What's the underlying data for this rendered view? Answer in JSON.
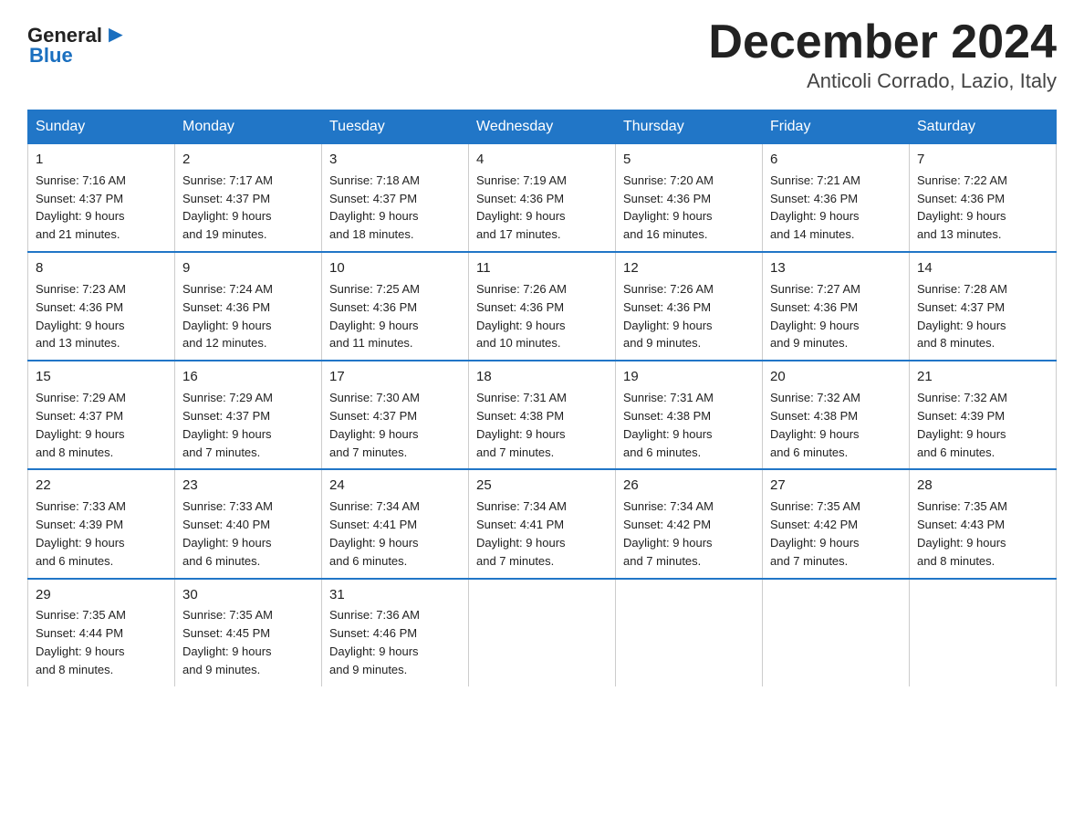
{
  "header": {
    "logo_general": "General",
    "logo_blue": "Blue",
    "month_title": "December 2024",
    "location": "Anticoli Corrado, Lazio, Italy"
  },
  "days_of_week": [
    "Sunday",
    "Monday",
    "Tuesday",
    "Wednesday",
    "Thursday",
    "Friday",
    "Saturday"
  ],
  "weeks": [
    [
      {
        "day": "1",
        "sunrise": "7:16 AM",
        "sunset": "4:37 PM",
        "daylight": "9 hours and 21 minutes."
      },
      {
        "day": "2",
        "sunrise": "7:17 AM",
        "sunset": "4:37 PM",
        "daylight": "9 hours and 19 minutes."
      },
      {
        "day": "3",
        "sunrise": "7:18 AM",
        "sunset": "4:37 PM",
        "daylight": "9 hours and 18 minutes."
      },
      {
        "day": "4",
        "sunrise": "7:19 AM",
        "sunset": "4:36 PM",
        "daylight": "9 hours and 17 minutes."
      },
      {
        "day": "5",
        "sunrise": "7:20 AM",
        "sunset": "4:36 PM",
        "daylight": "9 hours and 16 minutes."
      },
      {
        "day": "6",
        "sunrise": "7:21 AM",
        "sunset": "4:36 PM",
        "daylight": "9 hours and 14 minutes."
      },
      {
        "day": "7",
        "sunrise": "7:22 AM",
        "sunset": "4:36 PM",
        "daylight": "9 hours and 13 minutes."
      }
    ],
    [
      {
        "day": "8",
        "sunrise": "7:23 AM",
        "sunset": "4:36 PM",
        "daylight": "9 hours and 13 minutes."
      },
      {
        "day": "9",
        "sunrise": "7:24 AM",
        "sunset": "4:36 PM",
        "daylight": "9 hours and 12 minutes."
      },
      {
        "day": "10",
        "sunrise": "7:25 AM",
        "sunset": "4:36 PM",
        "daylight": "9 hours and 11 minutes."
      },
      {
        "day": "11",
        "sunrise": "7:26 AM",
        "sunset": "4:36 PM",
        "daylight": "9 hours and 10 minutes."
      },
      {
        "day": "12",
        "sunrise": "7:26 AM",
        "sunset": "4:36 PM",
        "daylight": "9 hours and 9 minutes."
      },
      {
        "day": "13",
        "sunrise": "7:27 AM",
        "sunset": "4:36 PM",
        "daylight": "9 hours and 9 minutes."
      },
      {
        "day": "14",
        "sunrise": "7:28 AM",
        "sunset": "4:37 PM",
        "daylight": "9 hours and 8 minutes."
      }
    ],
    [
      {
        "day": "15",
        "sunrise": "7:29 AM",
        "sunset": "4:37 PM",
        "daylight": "9 hours and 8 minutes."
      },
      {
        "day": "16",
        "sunrise": "7:29 AM",
        "sunset": "4:37 PM",
        "daylight": "9 hours and 7 minutes."
      },
      {
        "day": "17",
        "sunrise": "7:30 AM",
        "sunset": "4:37 PM",
        "daylight": "9 hours and 7 minutes."
      },
      {
        "day": "18",
        "sunrise": "7:31 AM",
        "sunset": "4:38 PM",
        "daylight": "9 hours and 7 minutes."
      },
      {
        "day": "19",
        "sunrise": "7:31 AM",
        "sunset": "4:38 PM",
        "daylight": "9 hours and 6 minutes."
      },
      {
        "day": "20",
        "sunrise": "7:32 AM",
        "sunset": "4:38 PM",
        "daylight": "9 hours and 6 minutes."
      },
      {
        "day": "21",
        "sunrise": "7:32 AM",
        "sunset": "4:39 PM",
        "daylight": "9 hours and 6 minutes."
      }
    ],
    [
      {
        "day": "22",
        "sunrise": "7:33 AM",
        "sunset": "4:39 PM",
        "daylight": "9 hours and 6 minutes."
      },
      {
        "day": "23",
        "sunrise": "7:33 AM",
        "sunset": "4:40 PM",
        "daylight": "9 hours and 6 minutes."
      },
      {
        "day": "24",
        "sunrise": "7:34 AM",
        "sunset": "4:41 PM",
        "daylight": "9 hours and 6 minutes."
      },
      {
        "day": "25",
        "sunrise": "7:34 AM",
        "sunset": "4:41 PM",
        "daylight": "9 hours and 7 minutes."
      },
      {
        "day": "26",
        "sunrise": "7:34 AM",
        "sunset": "4:42 PM",
        "daylight": "9 hours and 7 minutes."
      },
      {
        "day": "27",
        "sunrise": "7:35 AM",
        "sunset": "4:42 PM",
        "daylight": "9 hours and 7 minutes."
      },
      {
        "day": "28",
        "sunrise": "7:35 AM",
        "sunset": "4:43 PM",
        "daylight": "9 hours and 8 minutes."
      }
    ],
    [
      {
        "day": "29",
        "sunrise": "7:35 AM",
        "sunset": "4:44 PM",
        "daylight": "9 hours and 8 minutes."
      },
      {
        "day": "30",
        "sunrise": "7:35 AM",
        "sunset": "4:45 PM",
        "daylight": "9 hours and 9 minutes."
      },
      {
        "day": "31",
        "sunrise": "7:36 AM",
        "sunset": "4:46 PM",
        "daylight": "9 hours and 9 minutes."
      },
      null,
      null,
      null,
      null
    ]
  ]
}
